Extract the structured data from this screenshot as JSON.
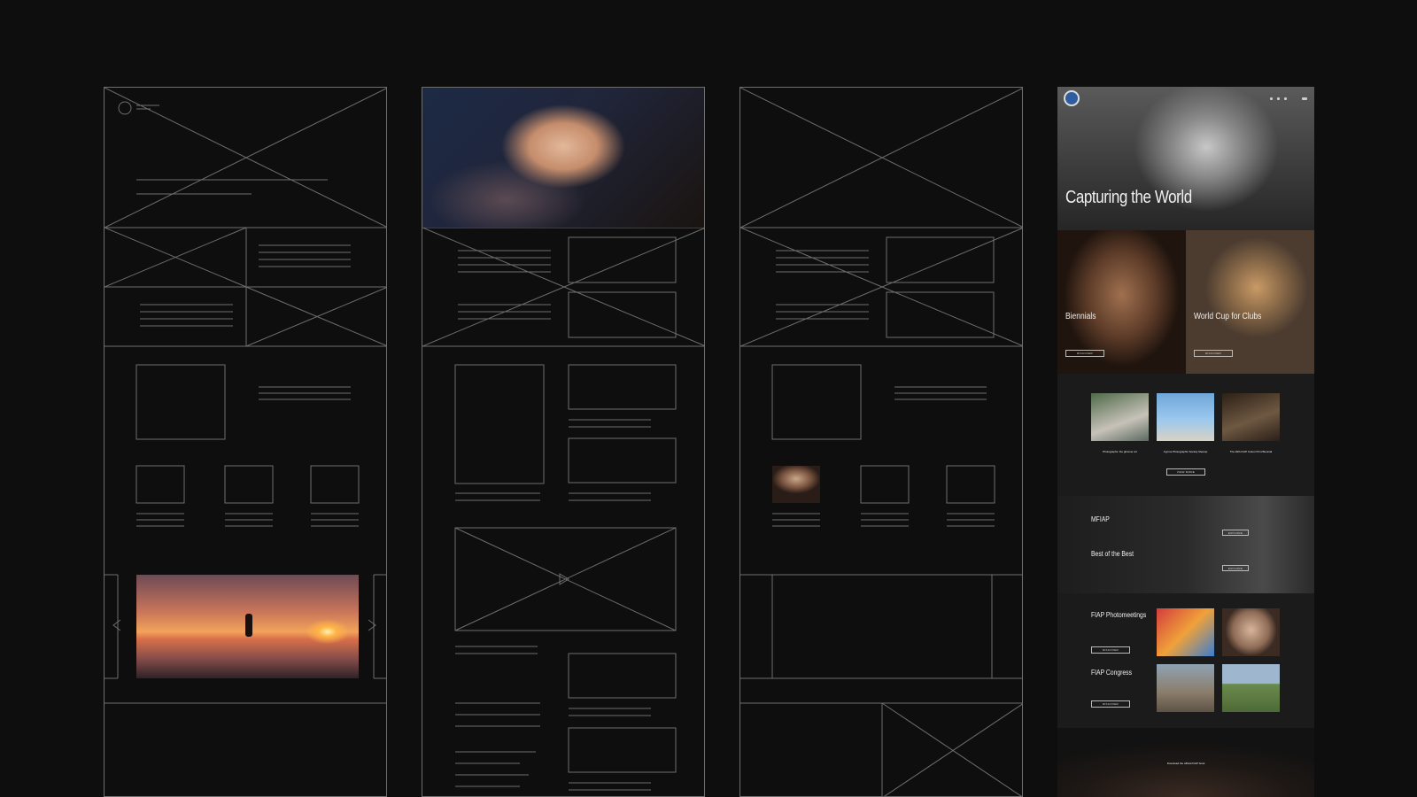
{
  "site": {
    "hero": {
      "title": "Capturing the World",
      "subtitle": "",
      "credit": ""
    },
    "biennials": {
      "title": "Biennials",
      "button": "DISCOVER"
    },
    "world_cup": {
      "title": "World Cup for Clubs",
      "button": "DISCOVER"
    },
    "news": {
      "items": [
        {
          "caption": "Photographs: the glimmer art"
        },
        {
          "caption": "Cyprus Photographic Society Meetup"
        },
        {
          "caption": "The 29th FIAP Colour Print Biennial"
        }
      ],
      "view_more": "VIEW MORE"
    },
    "mfiap": {
      "title": "MFIAP",
      "best": "Best of the Best",
      "button1": "EXPLORE",
      "button2": "EXPLORE"
    },
    "photomeetings": {
      "title": "FIAP Photomeetings",
      "button": "DISCOVER"
    },
    "congress": {
      "title": "FIAP Congress",
      "button": "DISCOVER"
    },
    "footer": {
      "download": "Download the official FIAP book"
    }
  }
}
